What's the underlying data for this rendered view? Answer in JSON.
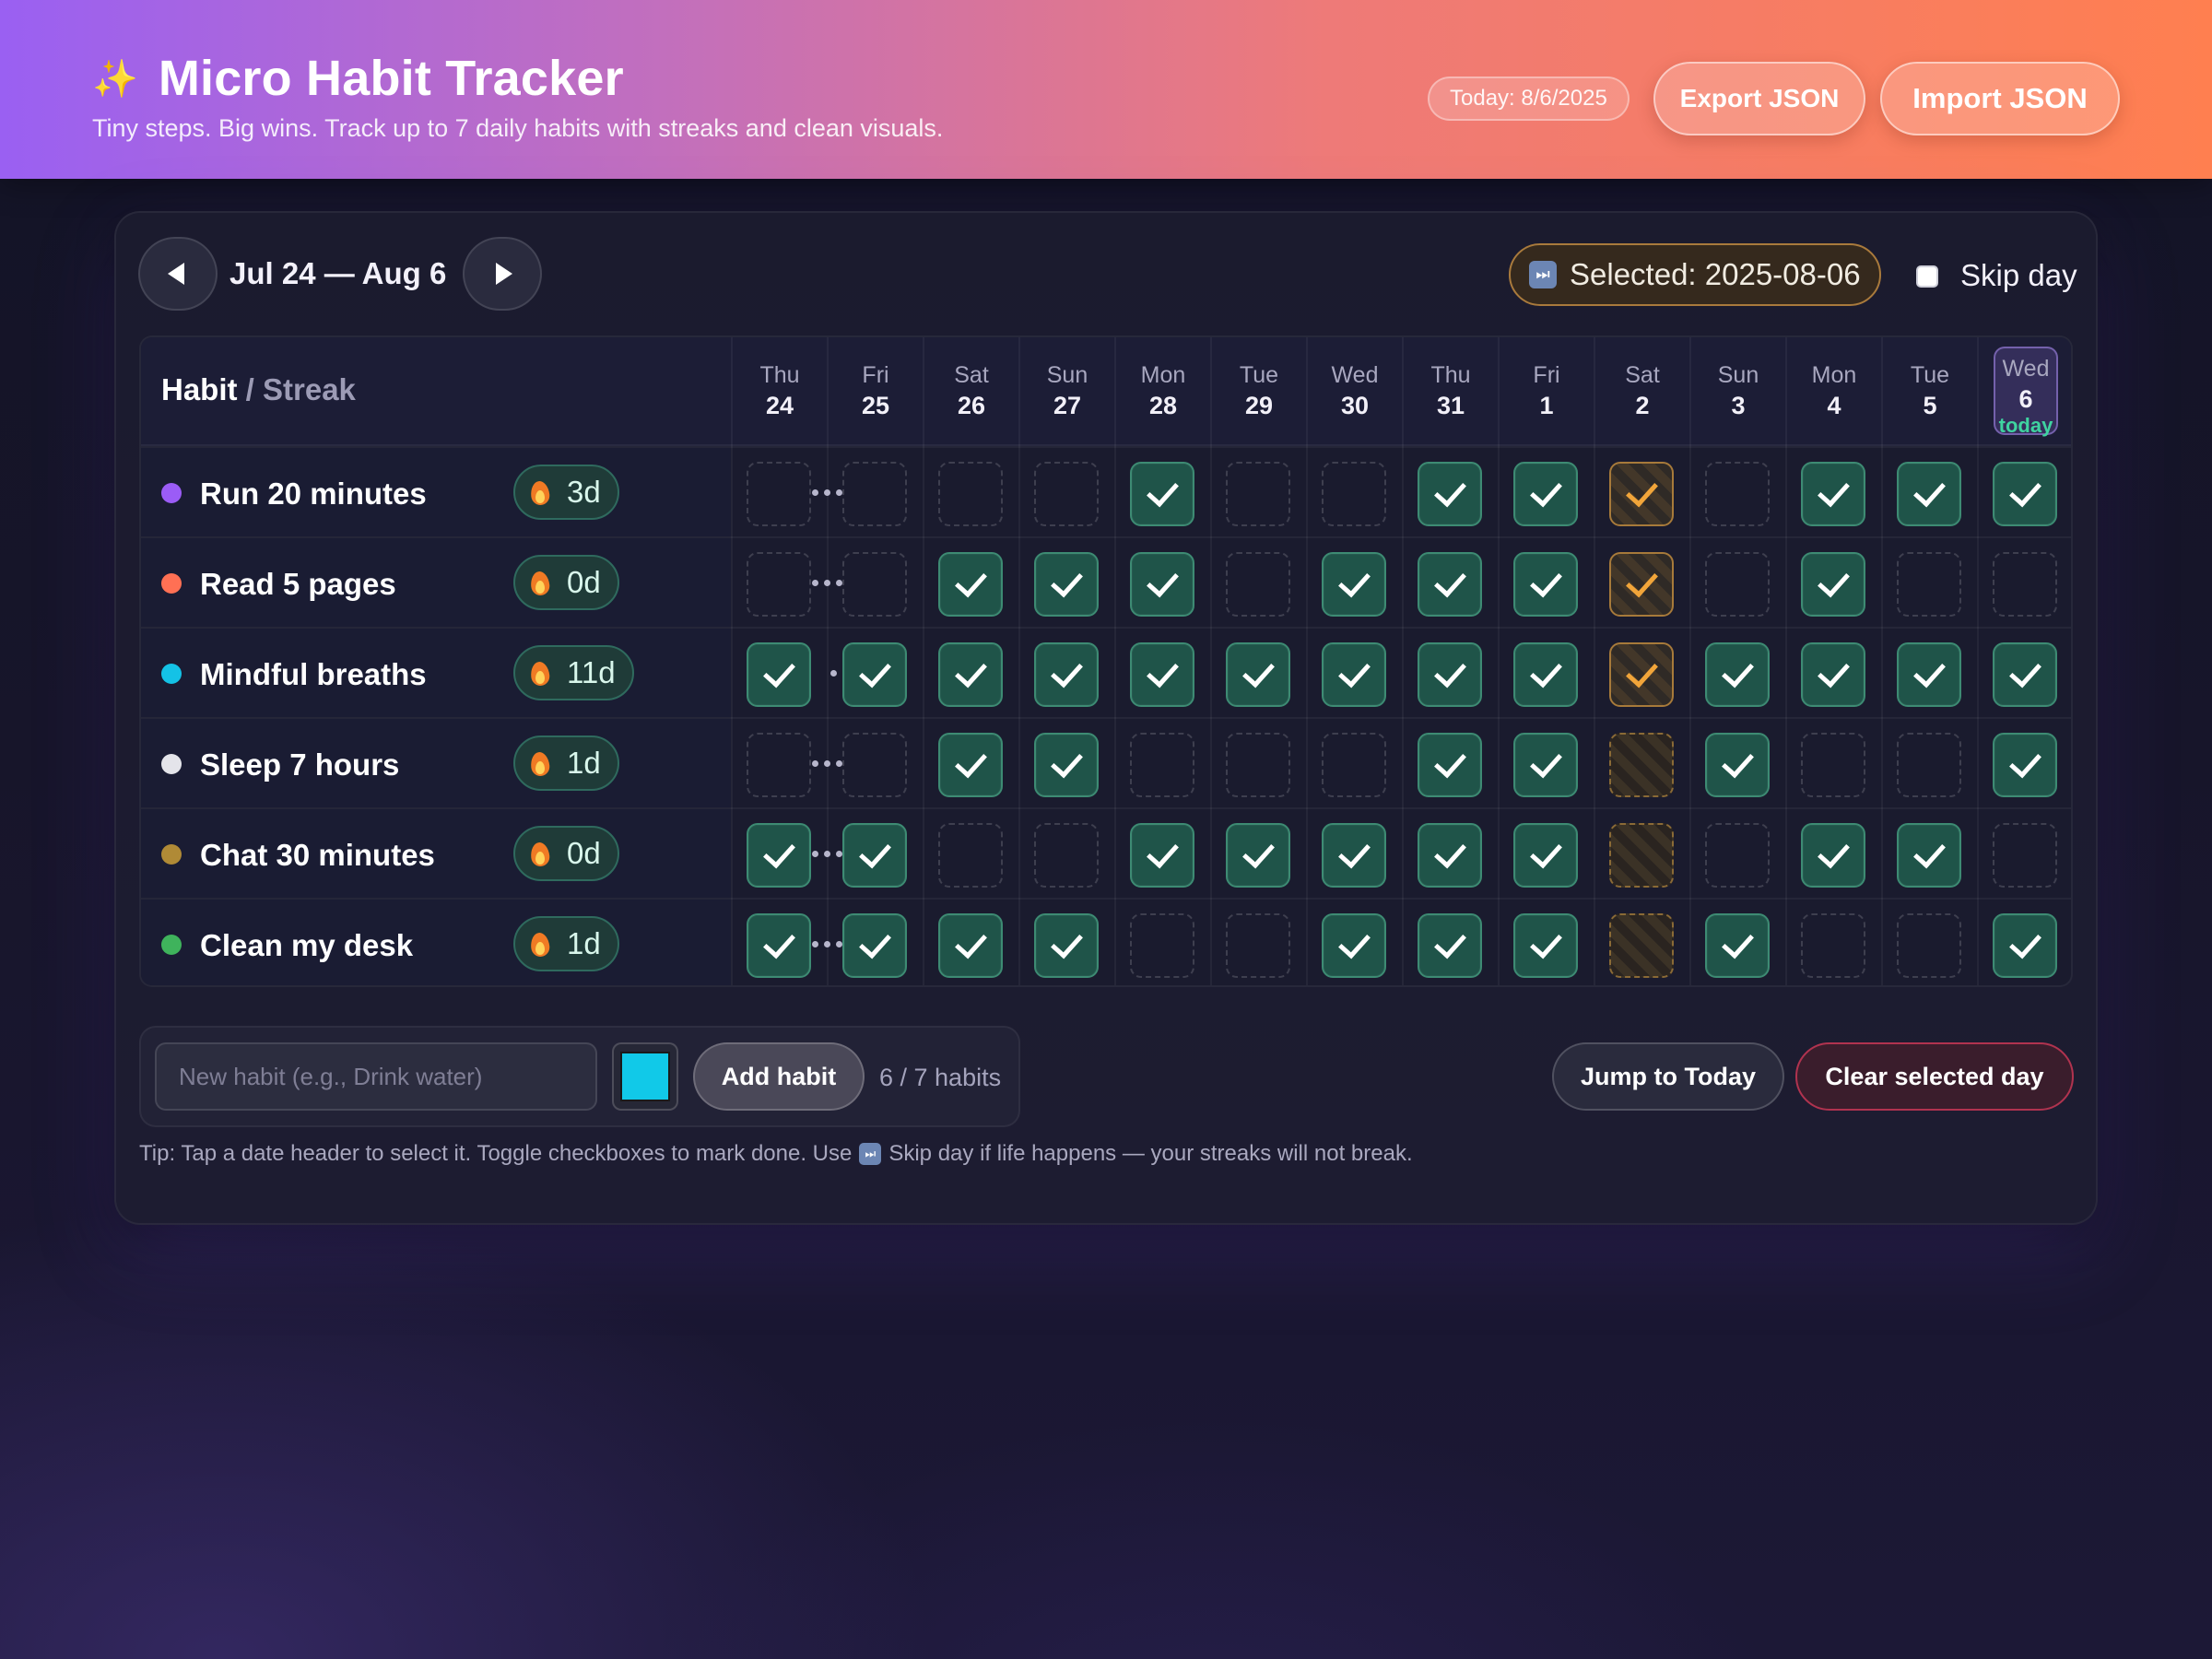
{
  "header": {
    "sparkle_icon": "✨",
    "title": "Micro Habit Tracker",
    "subtitle": "Tiny steps. Big wins. Track up to 7 daily habits with streaks and clean visuals.",
    "today_label": "Today: 8/6/2025",
    "export_label": "Export JSON",
    "import_label": "Import JSON"
  },
  "nav": {
    "range_label": "Jul 24 — Aug 6",
    "selected_label": "Selected: 2025-08-06",
    "skip_icon": "⏭",
    "skip_day_label": "Skip day",
    "skip_day_checked": false
  },
  "grid": {
    "habit_header": "Habit",
    "streak_header": "/ Streak",
    "today_tag": "today",
    "days": [
      {
        "dow": "Thu",
        "num": "24"
      },
      {
        "dow": "Fri",
        "num": "25"
      },
      {
        "dow": "Sat",
        "num": "26"
      },
      {
        "dow": "Sun",
        "num": "27"
      },
      {
        "dow": "Mon",
        "num": "28"
      },
      {
        "dow": "Tue",
        "num": "29"
      },
      {
        "dow": "Wed",
        "num": "30"
      },
      {
        "dow": "Thu",
        "num": "31"
      },
      {
        "dow": "Fri",
        "num": "1"
      },
      {
        "dow": "Sat",
        "num": "2"
      },
      {
        "dow": "Sun",
        "num": "3"
      },
      {
        "dow": "Mon",
        "num": "4"
      },
      {
        "dow": "Tue",
        "num": "5"
      },
      {
        "dow": "Wed",
        "num": "6"
      }
    ],
    "today_index": 13,
    "skipped_day_index": 9,
    "habits": [
      {
        "name": "Run 20 minutes",
        "color": "#9b5cf6",
        "streak": "3d",
        "done": [
          0,
          0,
          0,
          0,
          1,
          0,
          0,
          1,
          1,
          1,
          0,
          1,
          1,
          1
        ]
      },
      {
        "name": "Read 5 pages",
        "color": "#ff7054",
        "streak": "0d",
        "done": [
          0,
          0,
          1,
          1,
          1,
          0,
          1,
          1,
          1,
          1,
          0,
          1,
          0,
          0
        ]
      },
      {
        "name": "Mindful breaths",
        "color": "#14c2e6",
        "streak": "11d",
        "done": [
          1,
          1,
          1,
          1,
          1,
          1,
          1,
          1,
          1,
          1,
          1,
          1,
          1,
          1
        ]
      },
      {
        "name": "Sleep 7 hours",
        "color": "#e4e4ea",
        "streak": "1d",
        "done": [
          0,
          0,
          1,
          1,
          0,
          0,
          0,
          1,
          1,
          0,
          1,
          0,
          0,
          1
        ]
      },
      {
        "name": "Chat 30 minutes",
        "color": "#b08a36",
        "streak": "0d",
        "done": [
          1,
          1,
          0,
          0,
          1,
          1,
          1,
          1,
          1,
          0,
          0,
          1,
          1,
          0
        ]
      },
      {
        "name": "Clean my desk",
        "color": "#3fb35c",
        "streak": "1d",
        "done": [
          1,
          1,
          1,
          1,
          0,
          0,
          1,
          1,
          1,
          0,
          1,
          0,
          0,
          1
        ]
      }
    ]
  },
  "add": {
    "placeholder": "New habit (e.g., Drink water)",
    "value": "",
    "swatch_color": "#11c9e8",
    "add_label": "Add habit",
    "count_label": "6 / 7 habits"
  },
  "actions": {
    "jump_label": "Jump to Today",
    "clear_label": "Clear selected day"
  },
  "tip": {
    "prefix": "Tip: Tap a date header to select it. Toggle checkboxes to mark done. Use",
    "suffix": "Skip day if life happens — your streaks will not break."
  },
  "colors": {
    "header_gradient_start": "#9a60f2",
    "header_gradient_end": "#ff7f50",
    "done_fill": "#1f5449",
    "done_border": "#3d8b73",
    "skip_accent": "#f1a53a",
    "today_accent": "#3fd3a0",
    "danger": "#b0334f"
  }
}
